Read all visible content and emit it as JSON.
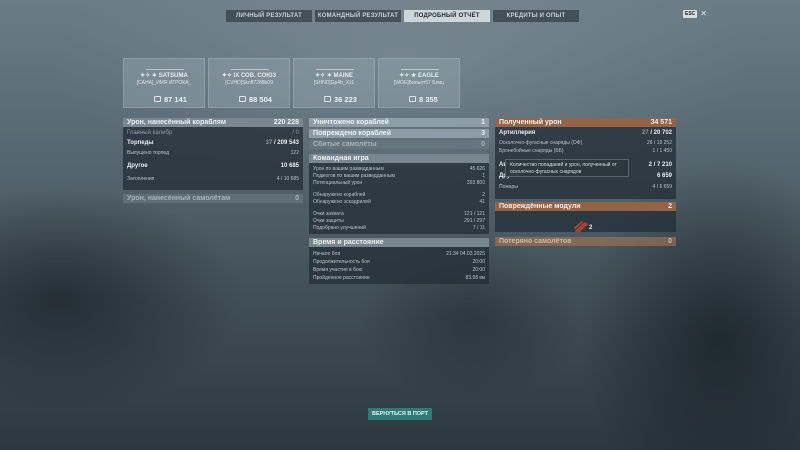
{
  "tabs": [
    {
      "label": "ЛИЧНЫЙ РЕЗУЛЬТАТ"
    },
    {
      "label": "КОМАНДНЫЙ РЕЗУЛЬТАТ"
    },
    {
      "label": "ПОДРОБНЫЙ ОТЧЁТ"
    },
    {
      "label": "КРЕДИТЫ И ОПЫТ"
    }
  ],
  "esc": {
    "key": "ESC",
    "close": "✕"
  },
  "cards": [
    {
      "ship": "✦✧ ✶ SATSUMA",
      "player": "[CAHA]_ИМЯ ИГРОКА_",
      "damage": "87 141"
    },
    {
      "ship": "✦✧ IX СОВ. СОЮЗ",
      "player": "[CVHD]Skoff7288b09",
      "damage": "88 504"
    },
    {
      "ship": "✦✧ ✶ MAINE",
      "player": "[SHND]Gp4b_X11",
      "damage": "36 223"
    },
    {
      "ship": "✦✧ ★ EAGLE",
      "player": "[WOE]Бильят57 Блиц",
      "damage": "8 355"
    }
  ],
  "left": {
    "damage_header": {
      "label": "Урон, нанесённый кораблям",
      "value": "220 228"
    },
    "main_caliber": {
      "label": "Главный калибр",
      "value": "/ 0"
    },
    "torpedoes": {
      "label": "Торпеды",
      "value_a": "37",
      "value_b": "/ 209 543"
    },
    "torpedoes_fired": {
      "label": "Выпущено торпед",
      "value": "122"
    },
    "other": {
      "label": "Другое",
      "value": "10 685"
    },
    "flooding": {
      "label": "Затопления",
      "value": "4 / 10 685"
    },
    "aircraft_header": {
      "label": "Урон, нанесённый самолётам",
      "value": "0"
    }
  },
  "middle": {
    "destroyed": {
      "label": "Уничтожено кораблей",
      "value": "1"
    },
    "damaged": {
      "label": "Повреждено кораблей",
      "value": "3"
    },
    "planes_shot": {
      "label": "Сбитые самолёты",
      "value": "0"
    },
    "team_header": "Командная игра",
    "team_rows": [
      {
        "label": "Урон по вашим разведданным",
        "value": "45 626"
      },
      {
        "label": "Поджогов по вашим разведданным",
        "value": "1"
      },
      {
        "label": "Потенциальный урон",
        "value": "393 800"
      },
      {
        "label": "",
        "value": ""
      },
      {
        "label": "Обнаружено кораблей",
        "value": "2"
      },
      {
        "label": "Обнаружено эскадрилий",
        "value": "41"
      },
      {
        "label": "",
        "value": ""
      },
      {
        "label": "Очки захвата",
        "value": "121 / 121"
      },
      {
        "label": "Очки защиты",
        "value": "291 / 297"
      },
      {
        "label": "Подобрано улучшений",
        "value": "7 / 11"
      }
    ],
    "time_header": "Время и расстояние",
    "time_rows": [
      {
        "label": "Начало боя",
        "value": "21:34 04.03.2025"
      },
      {
        "label": "Продолжительность боя",
        "value": "20:00"
      },
      {
        "label": "Время участия в бою",
        "value": "20:00"
      },
      {
        "label": "Пройденное расстояние",
        "value": "83.98 км"
      }
    ]
  },
  "right": {
    "received_header": {
      "label": "Полученный урон",
      "value": "34 571"
    },
    "artillery": {
      "label": "Артиллерия",
      "value_a": "27",
      "value_b": "/ 20 702"
    },
    "he_shells": {
      "label": "Осколочно-фугасные снаряды (ОФ)",
      "value": "26 / 19 252"
    },
    "ap_shells": {
      "label": "Бронебойные снаряды (ББ)",
      "value": "1 / 1 450"
    },
    "aviation": {
      "label": "Авиа",
      "value": "2 / 7 210"
    },
    "other": {
      "label": "Другое",
      "value": "6 659"
    },
    "fires": {
      "label": "Пожары",
      "value": "4 / 6 659"
    },
    "modules_header": {
      "label": "Повреждённые модули",
      "value": "2"
    },
    "module_count": "2",
    "planes_lost": {
      "label": "Потеряно самолётов",
      "value": "0"
    }
  },
  "tooltip": "Количество попаданий и урон, полученный от осколочно-фугасных снарядов",
  "back_button": "ВЕРНУТЬСЯ В ПОРТ"
}
